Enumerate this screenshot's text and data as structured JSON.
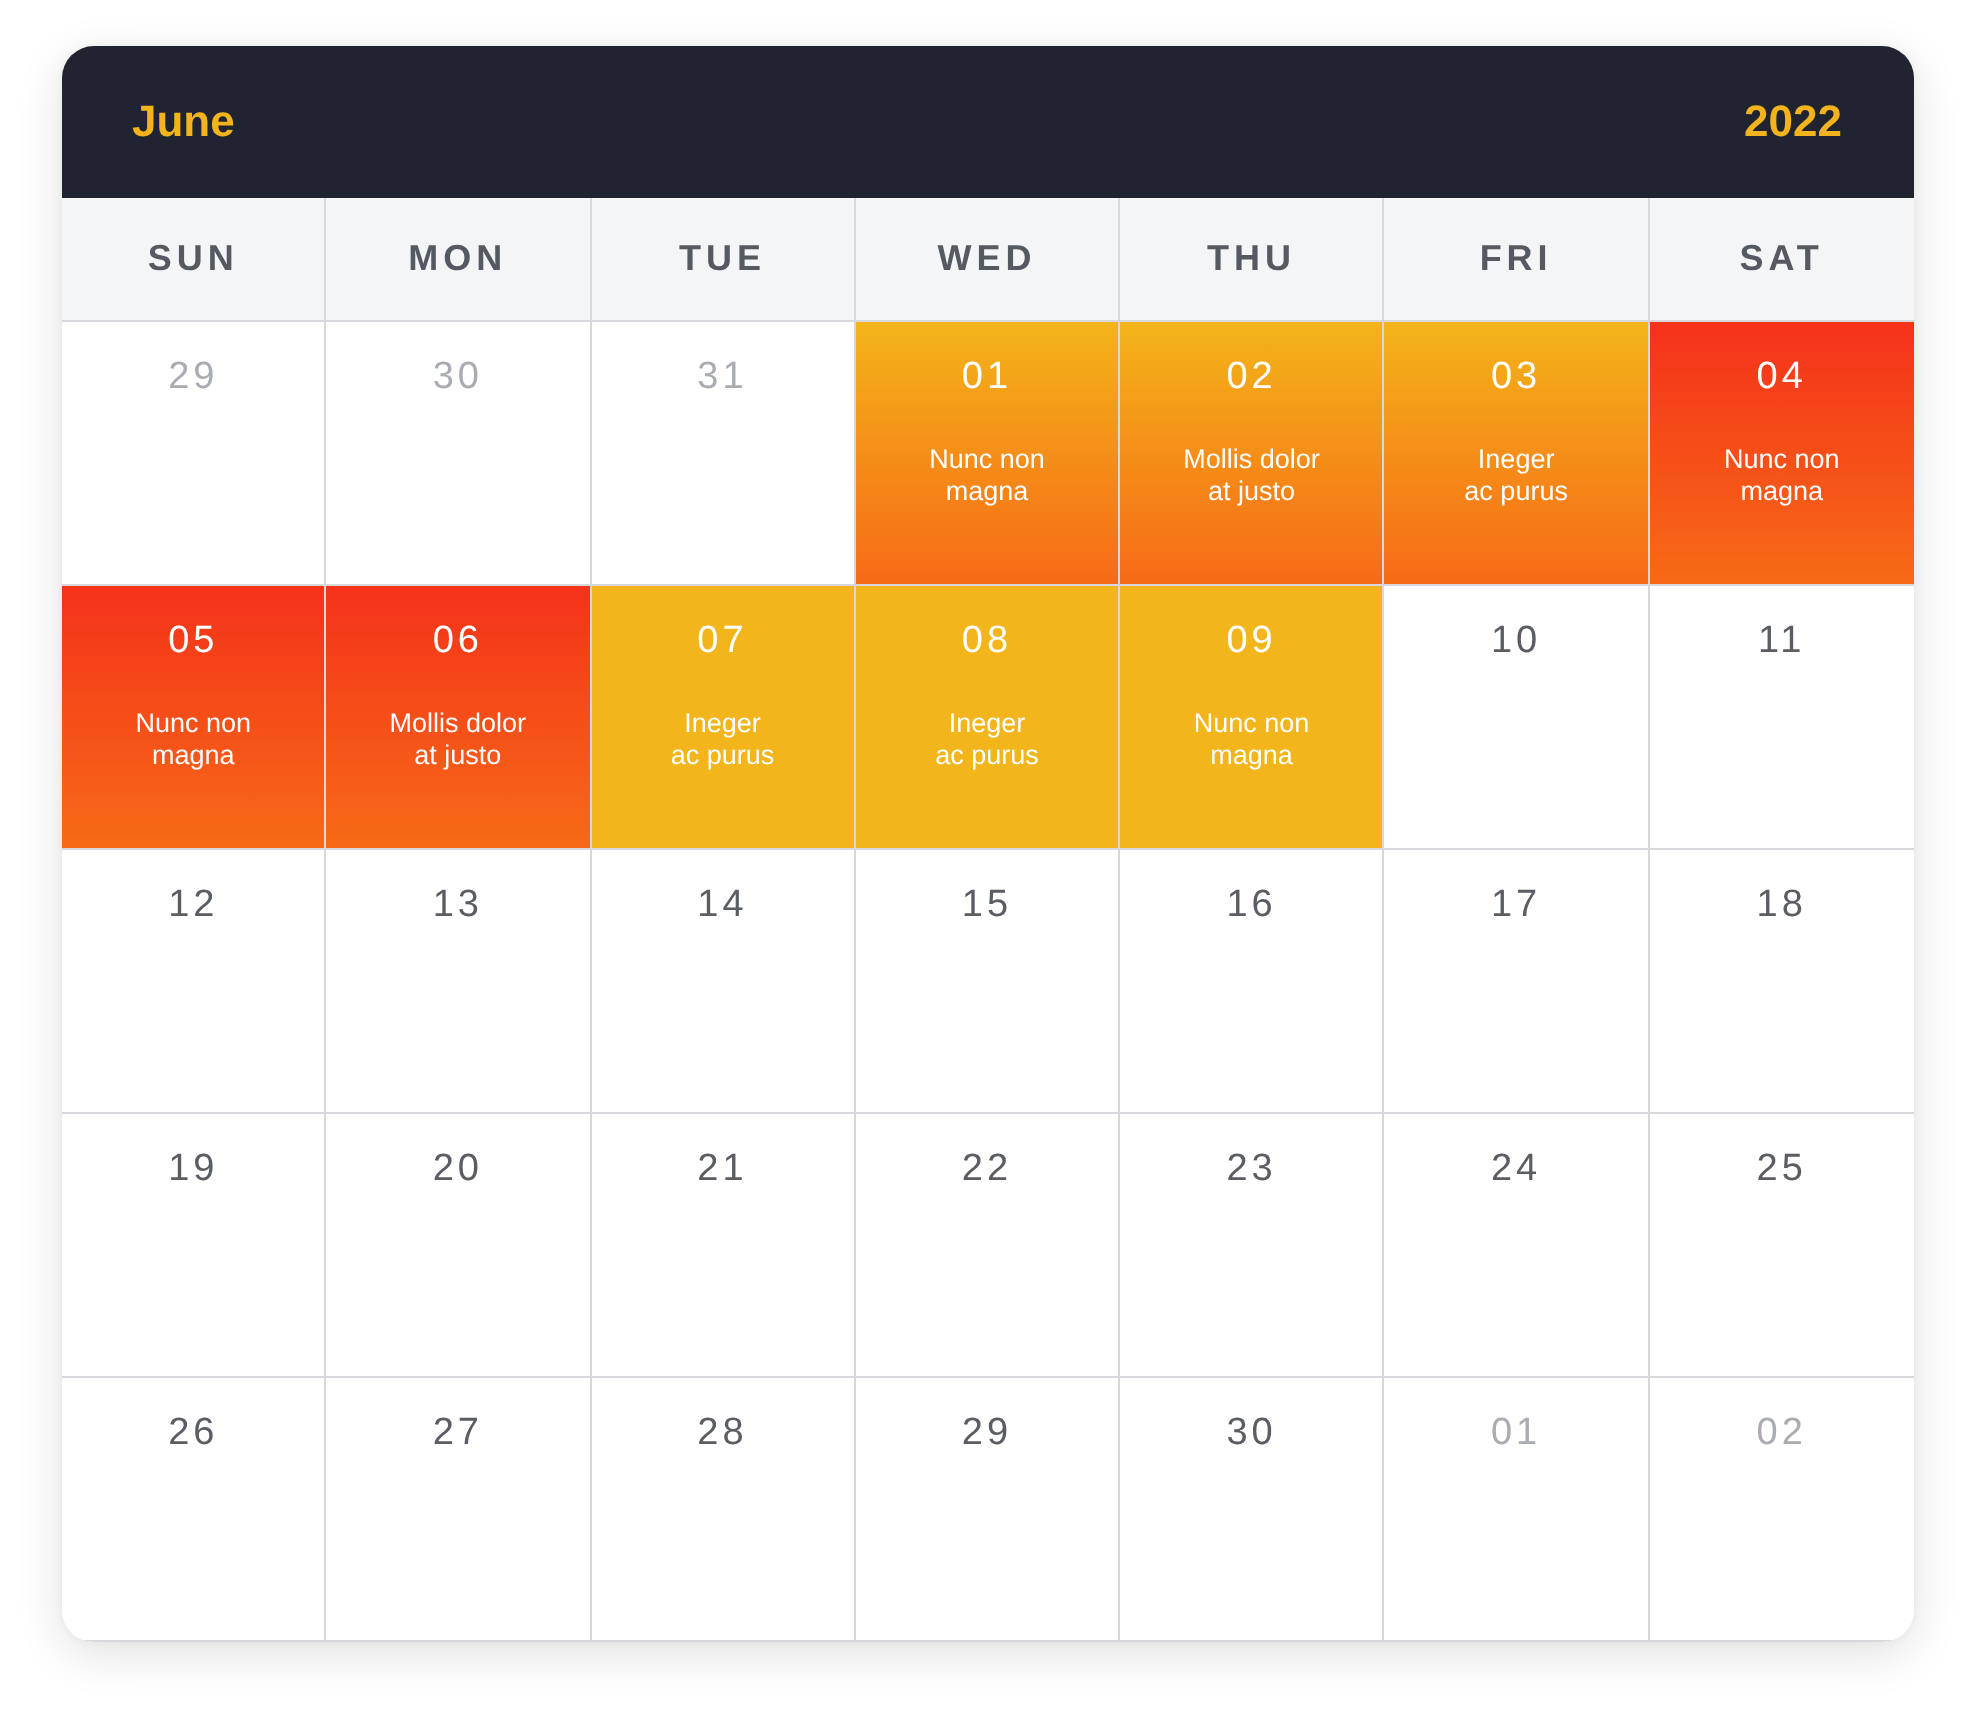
{
  "header": {
    "month": "June",
    "year": "2022"
  },
  "weekdays": [
    "SUN",
    "MON",
    "TUE",
    "WED",
    "THU",
    "FRI",
    "SAT"
  ],
  "weeks": [
    [
      {
        "day": "29",
        "muted": true
      },
      {
        "day": "30",
        "muted": true
      },
      {
        "day": "31",
        "muted": true
      },
      {
        "day": "01",
        "muted": false,
        "kind": "orange",
        "event": "Nunc non\nmagna"
      },
      {
        "day": "02",
        "muted": false,
        "kind": "orange",
        "event": "Mollis dolor\nat justo"
      },
      {
        "day": "03",
        "muted": false,
        "kind": "orange",
        "event": "Ineger\nac purus"
      },
      {
        "day": "04",
        "muted": false,
        "kind": "red",
        "event": "Nunc non\nmagna"
      }
    ],
    [
      {
        "day": "05",
        "muted": false,
        "kind": "red",
        "event": "Nunc non\nmagna"
      },
      {
        "day": "06",
        "muted": false,
        "kind": "red",
        "event": "Mollis dolor\nat justo"
      },
      {
        "day": "07",
        "muted": false,
        "kind": "yellow",
        "event": "Ineger\nac purus"
      },
      {
        "day": "08",
        "muted": false,
        "kind": "yellow",
        "event": "Ineger\nac purus"
      },
      {
        "day": "09",
        "muted": false,
        "kind": "yellow",
        "event": "Nunc non\nmagna"
      },
      {
        "day": "10",
        "muted": false
      },
      {
        "day": "11",
        "muted": false
      }
    ],
    [
      {
        "day": "12",
        "muted": false
      },
      {
        "day": "13",
        "muted": false
      },
      {
        "day": "14",
        "muted": false
      },
      {
        "day": "15",
        "muted": false
      },
      {
        "day": "16",
        "muted": false
      },
      {
        "day": "17",
        "muted": false
      },
      {
        "day": "18",
        "muted": false
      }
    ],
    [
      {
        "day": "19",
        "muted": false
      },
      {
        "day": "20",
        "muted": false
      },
      {
        "day": "21",
        "muted": false
      },
      {
        "day": "22",
        "muted": false
      },
      {
        "day": "23",
        "muted": false
      },
      {
        "day": "24",
        "muted": false
      },
      {
        "day": "25",
        "muted": false
      }
    ],
    [
      {
        "day": "26",
        "muted": false
      },
      {
        "day": "27",
        "muted": false
      },
      {
        "day": "28",
        "muted": false
      },
      {
        "day": "29",
        "muted": false
      },
      {
        "day": "30",
        "muted": false
      },
      {
        "day": "01",
        "muted": true
      },
      {
        "day": "02",
        "muted": true
      }
    ]
  ]
}
